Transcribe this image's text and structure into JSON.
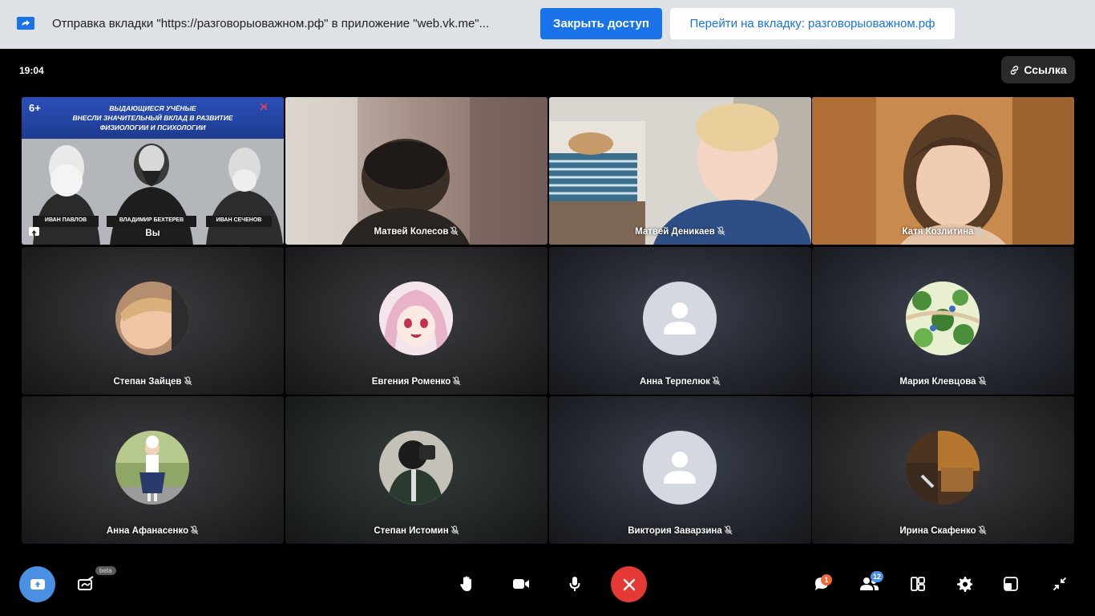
{
  "banner": {
    "text": "Отправка вкладки \"https://разговорыоважном.рф\" в приложение \"web.vk.me\"...",
    "close_access_label": "Закрыть доступ",
    "goto_tab_label": "Перейти на вкладку: разговорыоважном.рф"
  },
  "topbar": {
    "time": "19:04",
    "link_label": "Ссылка"
  },
  "presentation": {
    "age_rating": "6+",
    "title_line1": "ВЫДАЮЩИЕСЯ УЧЁНЫЕ",
    "title_line2": "ВНЕСЛИ ЗНАЧИТЕЛЬНЫЙ ВКЛАД В РАЗВИТИЕ",
    "title_line3": "ФИЗИОЛОГИИ И ПСИХОЛОГИИ",
    "scientist1": "ИВАН ПАВЛОВ",
    "scientist2": "ВЛАДИМИР БЕХТЕРЕВ",
    "scientist3": "ИВАН СЕЧЕНОВ",
    "you_label": "Вы"
  },
  "participants": [
    {
      "name": "Матвей Колесов"
    },
    {
      "name": "Матвей Деникаев"
    },
    {
      "name": "Катя Козлитина"
    },
    {
      "name": "Степан Зайцев"
    },
    {
      "name": "Евгения Роменко"
    },
    {
      "name": "Анна Терпелюк"
    },
    {
      "name": "Мария Клевцова"
    },
    {
      "name": "Анна Афанасенко"
    },
    {
      "name": "Степан Истомин"
    },
    {
      "name": "Виктория Заварзина"
    },
    {
      "name": "Ирина Скафенко"
    }
  ],
  "controls": {
    "beta_label": "beta",
    "chat_badge": "1",
    "participants_badge": "12"
  },
  "colors": {
    "accent": "#1a73e8",
    "hangup": "#e53935",
    "share_button": "#4a90e2"
  }
}
